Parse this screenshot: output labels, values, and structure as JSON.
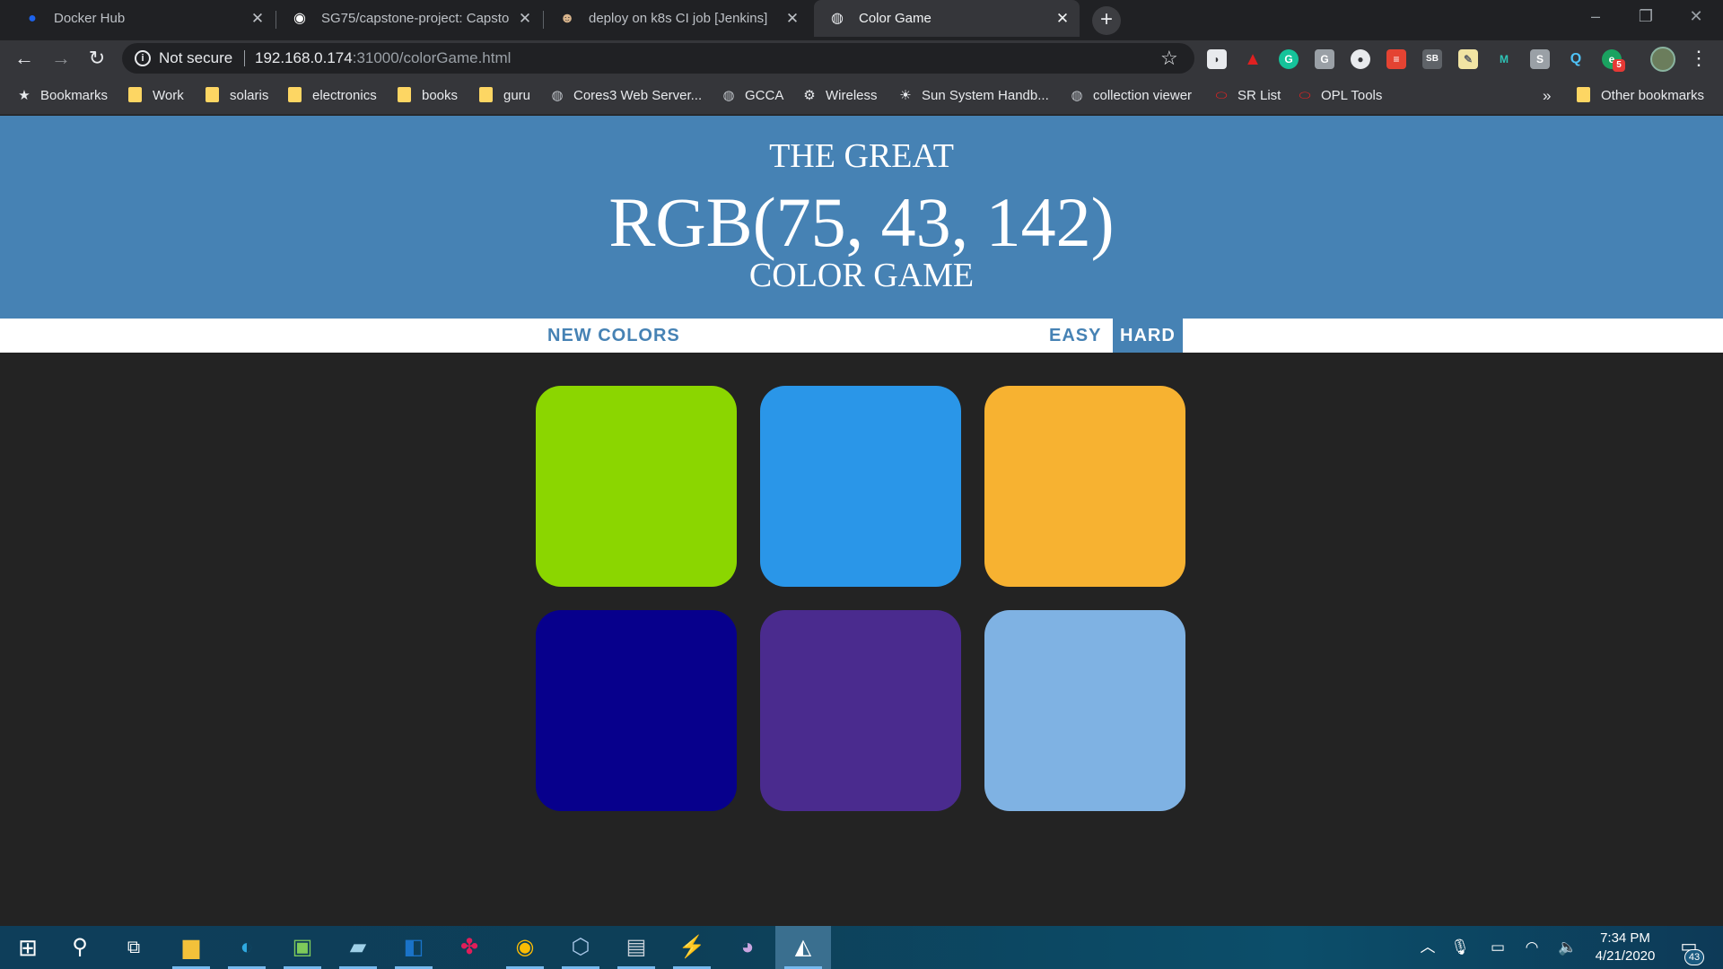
{
  "tabs": [
    {
      "title": "Docker Hub",
      "icon": "docker-icon"
    },
    {
      "title": "SG75/capstone-project: Capstone",
      "icon": "github-icon"
    },
    {
      "title": "deploy on k8s CI job [Jenkins]",
      "icon": "jenkins-icon"
    },
    {
      "title": "Color Game",
      "icon": "globe-icon",
      "active": true
    }
  ],
  "tab_close_glyph": "✕",
  "new_tab_glyph": "+",
  "omnibox": {
    "security": "Not secure",
    "host": "192.168.0.174",
    "path": ":31000/colorGame.html"
  },
  "bookmarks": [
    {
      "label": "Bookmarks",
      "icon": "star-icon"
    },
    {
      "label": "Work",
      "icon": "folder-icon"
    },
    {
      "label": "solaris",
      "icon": "folder-icon"
    },
    {
      "label": "electronics",
      "icon": "folder-icon"
    },
    {
      "label": "books",
      "icon": "folder-icon"
    },
    {
      "label": "guru",
      "icon": "folder-icon"
    },
    {
      "label": "Cores3 Web Server...",
      "icon": "globe-icon"
    },
    {
      "label": "GCCA",
      "icon": "globe-icon"
    },
    {
      "label": "Wireless",
      "icon": "wireless-icon"
    },
    {
      "label": "Sun System Handb...",
      "icon": "sun-icon"
    },
    {
      "label": "collection viewer",
      "icon": "globe-icon"
    },
    {
      "label": "SR List",
      "icon": "oracle-icon"
    },
    {
      "label": "OPL Tools",
      "icon": "oracle-icon"
    },
    {
      "label": "Other bookmarks",
      "icon": "folder-icon"
    }
  ],
  "overflow_glyph": "»",
  "game": {
    "title_top": "THE GREAT",
    "title_rgb": "RGB(75, 43, 142)",
    "title_bottom": "COLOR GAME",
    "new_colors": "NEW COLORS",
    "easy": "EASY",
    "hard": "HARD",
    "mode": "hard",
    "header_color": "#4682b4",
    "background_color": "#232323",
    "squares": [
      "#8bd600",
      "#2a96e8",
      "#f7b231",
      "#07008c",
      "#4a2b8e",
      "#7fb2e3"
    ]
  },
  "taskbar": {
    "clock_time": "7:34 PM",
    "clock_date": "4/21/2020",
    "notification_count": "43",
    "extension_badge": "5"
  }
}
